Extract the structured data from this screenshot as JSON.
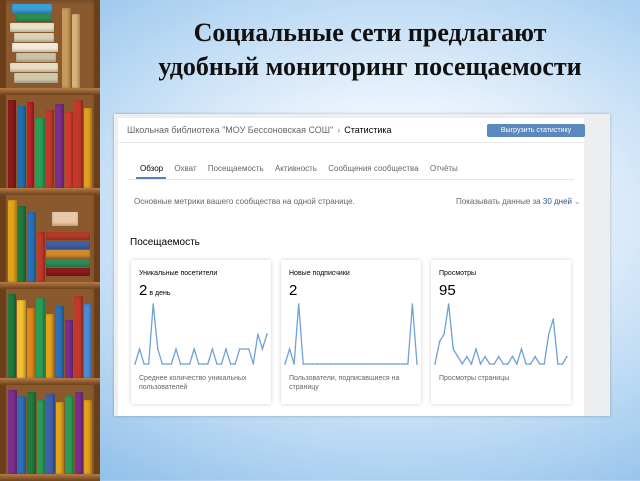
{
  "slide": {
    "title_line1": "Социальные сети предлагают",
    "title_line2": "удобный мониторинг посещаемости"
  },
  "header": {
    "community": "Школьная библиотека \"МОУ Бессоновская СОШ\"",
    "page": "Статистика",
    "export_label": "Выгрузить статистику"
  },
  "tabs": [
    "Обзор",
    "Охват",
    "Посещаемость",
    "Активность",
    "Сообщения сообщества",
    "Отчёты"
  ],
  "active_tab": "Обзор",
  "metrics_desc": "Основные метрики вашего сообщества на одной странице.",
  "period": {
    "label": "Показывать данные за",
    "value": "30 дней"
  },
  "section_title": "Посещаемость",
  "colors": {
    "accent": "#5181b8",
    "line": "#6fa0d8",
    "panel_bg": "#edeef0"
  },
  "stats": [
    {
      "label": "Уникальные посетители",
      "value": "2",
      "unit": "в день",
      "description": "Среднее количество уникальных пользователей",
      "series": [
        0,
        1,
        0,
        0,
        4,
        1,
        0,
        0,
        0,
        1,
        0,
        0,
        0,
        1,
        0,
        0,
        0,
        1,
        0,
        0,
        1,
        0,
        0,
        1,
        1,
        1,
        0,
        2,
        1,
        2
      ]
    },
    {
      "label": "Новые подписчики",
      "value": "2",
      "unit": "",
      "description": "Пользователи, подписавшиеся на страницу",
      "series": [
        0,
        1,
        0,
        4,
        0,
        0,
        0,
        0,
        0,
        0,
        0,
        0,
        0,
        0,
        0,
        0,
        0,
        0,
        0,
        0,
        0,
        0,
        0,
        0,
        0,
        0,
        0,
        0,
        4,
        0
      ]
    },
    {
      "label": "Просмотры",
      "value": "95",
      "unit": "",
      "description": "Просмотры страницы",
      "series": [
        0,
        3,
        4,
        8,
        2,
        1,
        0,
        1,
        0,
        2,
        0,
        1,
        0,
        0,
        1,
        0,
        0,
        1,
        0,
        2,
        0,
        0,
        1,
        0,
        0,
        4,
        6,
        0,
        0,
        1
      ]
    }
  ],
  "chart_data": [
    {
      "type": "line",
      "title": "Уникальные посетители",
      "x": [
        1,
        2,
        3,
        4,
        5,
        6,
        7,
        8,
        9,
        10,
        11,
        12,
        13,
        14,
        15,
        16,
        17,
        18,
        19,
        20,
        21,
        22,
        23,
        24,
        25,
        26,
        27,
        28,
        29,
        30
      ],
      "series": [
        {
          "values": [
            0,
            1,
            0,
            0,
            4,
            1,
            0,
            0,
            0,
            1,
            0,
            0,
            0,
            1,
            0,
            0,
            0,
            1,
            0,
            0,
            1,
            0,
            0,
            1,
            1,
            1,
            0,
            2,
            1,
            2
          ]
        }
      ],
      "grid": false
    },
    {
      "type": "line",
      "title": "Новые подписчики",
      "x": [
        1,
        2,
        3,
        4,
        5,
        6,
        7,
        8,
        9,
        10,
        11,
        12,
        13,
        14,
        15,
        16,
        17,
        18,
        19,
        20,
        21,
        22,
        23,
        24,
        25,
        26,
        27,
        28,
        29,
        30
      ],
      "series": [
        {
          "values": [
            0,
            1,
            0,
            4,
            0,
            0,
            0,
            0,
            0,
            0,
            0,
            0,
            0,
            0,
            0,
            0,
            0,
            0,
            0,
            0,
            0,
            0,
            0,
            0,
            0,
            0,
            0,
            0,
            4,
            0
          ]
        }
      ],
      "grid": false
    },
    {
      "type": "line",
      "title": "Просмотры",
      "x": [
        1,
        2,
        3,
        4,
        5,
        6,
        7,
        8,
        9,
        10,
        11,
        12,
        13,
        14,
        15,
        16,
        17,
        18,
        19,
        20,
        21,
        22,
        23,
        24,
        25,
        26,
        27,
        28,
        29,
        30
      ],
      "series": [
        {
          "values": [
            0,
            3,
            4,
            8,
            2,
            1,
            0,
            1,
            0,
            2,
            0,
            1,
            0,
            0,
            1,
            0,
            0,
            1,
            0,
            2,
            0,
            0,
            1,
            0,
            0,
            4,
            6,
            0,
            0,
            1
          ]
        }
      ],
      "grid": false
    }
  ]
}
